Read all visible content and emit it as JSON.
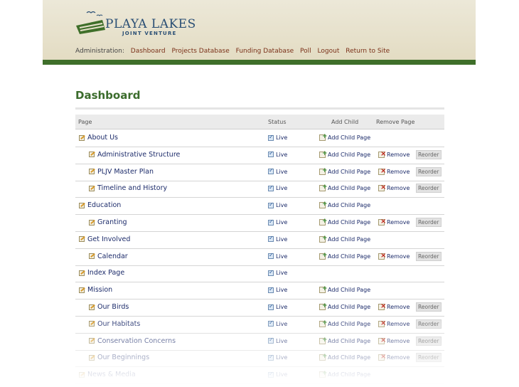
{
  "brand": {
    "name": "PLAYA LAKES",
    "tagline": "JOINT VENTURE",
    "colors": {
      "green": "#3f6f2a",
      "navy": "#294e74",
      "link": "#7a3018"
    }
  },
  "nav": {
    "label": "Administration:",
    "links": [
      "Dashboard",
      "Projects Database",
      "Funding Database",
      "Poll",
      "Logout",
      "Return to Site"
    ]
  },
  "page_title": "Dashboard",
  "table": {
    "headers": {
      "page": "Page",
      "status": "Status",
      "add_child": "Add Child",
      "remove_page": "Remove Page"
    },
    "rows": [
      {
        "name": "About Us",
        "level": 0,
        "status": "Live",
        "add": "Add Child Page",
        "remove": "",
        "reorder": ""
      },
      {
        "name": "Administrative Structure",
        "level": 1,
        "status": "Live",
        "add": "Add Child Page",
        "remove": "Remove",
        "reorder": "Reorder"
      },
      {
        "name": "PLJV Master Plan",
        "level": 1,
        "status": "Live",
        "add": "Add Child Page",
        "remove": "Remove",
        "reorder": "Reorder"
      },
      {
        "name": "Timeline and History",
        "level": 1,
        "status": "Live",
        "add": "Add Child Page",
        "remove": "Remove",
        "reorder": "Reorder"
      },
      {
        "name": "Education",
        "level": 0,
        "status": "Live",
        "add": "Add Child Page",
        "remove": "",
        "reorder": ""
      },
      {
        "name": "Granting",
        "level": 1,
        "status": "Live",
        "add": "Add Child Page",
        "remove": "Remove",
        "reorder": "Reorder"
      },
      {
        "name": "Get Involved",
        "level": 0,
        "status": "Live",
        "add": "Add Child Page",
        "remove": "",
        "reorder": ""
      },
      {
        "name": "Calendar",
        "level": 1,
        "status": "Live",
        "add": "Add Child Page",
        "remove": "Remove",
        "reorder": "Reorder"
      },
      {
        "name": "Index Page",
        "level": 0,
        "status": "Live",
        "add": "",
        "remove": "",
        "reorder": ""
      },
      {
        "name": "Mission",
        "level": 0,
        "status": "Live",
        "add": "Add Child Page",
        "remove": "",
        "reorder": ""
      },
      {
        "name": "Our Birds",
        "level": 1,
        "status": "Live",
        "add": "Add Child Page",
        "remove": "Remove",
        "reorder": "Reorder"
      },
      {
        "name": "Our Habitats",
        "level": 1,
        "status": "Live",
        "add": "Add Child Page",
        "remove": "Remove",
        "reorder": "Reorder"
      },
      {
        "name": "Conservation Concerns",
        "level": 1,
        "status": "Live",
        "add": "Add Child Page",
        "remove": "Remove",
        "reorder": "Reorder"
      },
      {
        "name": "Our Beginnings",
        "level": 1,
        "status": "Live",
        "add": "Add Child Page",
        "remove": "Remove",
        "reorder": "Reorder"
      },
      {
        "name": "News & Media",
        "level": 0,
        "status": "Live",
        "add": "Add Child Page",
        "remove": "",
        "reorder": ""
      }
    ]
  }
}
